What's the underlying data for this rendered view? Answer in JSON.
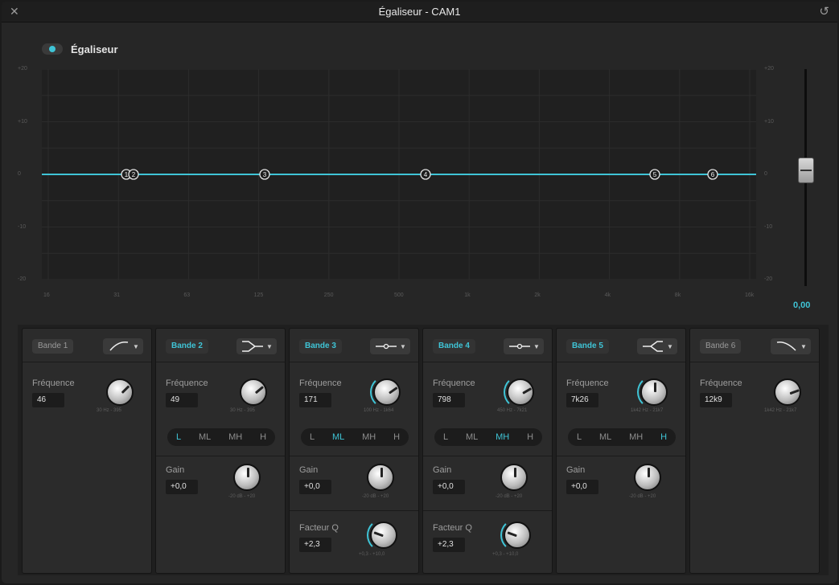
{
  "window": {
    "title": "Égaliseur - CAM1",
    "close_icon": "close-icon",
    "reset_icon": "reset-icon"
  },
  "eq_toggle": {
    "label": "Égaliseur",
    "enabled": true
  },
  "graph": {
    "y_labels": [
      "+20",
      "+10",
      "0",
      "-10",
      "-20"
    ],
    "y_labels_right": [
      "+20",
      "+10",
      "0",
      "-10",
      "-20"
    ],
    "x_labels": [
      "16",
      "31",
      "63",
      "125",
      "250",
      "500",
      "1k",
      "2k",
      "4k",
      "8k",
      "16k"
    ],
    "curve_color": "#3fc4d6",
    "nodes": [
      {
        "label": "1"
      },
      {
        "label": "2"
      },
      {
        "label": "3"
      },
      {
        "label": "4"
      },
      {
        "label": "5"
      },
      {
        "label": "6"
      }
    ]
  },
  "fader": {
    "value": "0,00",
    "level_db": 0
  },
  "bands": [
    {
      "name": "Bande 1",
      "active": false,
      "shape": "high-pass",
      "freq_label": "Fréquence",
      "freq": "46",
      "freq_range": "30 Hz - 395"
    },
    {
      "name": "Bande 2",
      "active": true,
      "shape": "low-shelf",
      "freq_label": "Fréquence",
      "freq": "49",
      "freq_range": "30 Hz - 395",
      "ranges": [
        "L",
        "ML",
        "MH",
        "H"
      ],
      "range_selected": "L",
      "gain_label": "Gain",
      "gain": "+0,0",
      "gain_range": "-20 dB - +20"
    },
    {
      "name": "Bande 3",
      "active": true,
      "shape": "bell",
      "freq_label": "Fréquence",
      "freq": "171",
      "freq_range": "100 Hz - 1k64",
      "ranges": [
        "L",
        "ML",
        "MH",
        "H"
      ],
      "range_selected": "ML",
      "gain_label": "Gain",
      "gain": "+0,0",
      "gain_range": "-20 dB - +20",
      "q_label": "Facteur Q",
      "q": "+2,3",
      "q_range": "+0,3 - +10,0"
    },
    {
      "name": "Bande 4",
      "active": true,
      "shape": "bell",
      "freq_label": "Fréquence",
      "freq": "798",
      "freq_range": "450 Hz - 7k21",
      "ranges": [
        "L",
        "ML",
        "MH",
        "H"
      ],
      "range_selected": "MH",
      "gain_label": "Gain",
      "gain": "+0,0",
      "gain_range": "-20 dB - +20",
      "q_label": "Facteur Q",
      "q": "+2,3",
      "q_range": "+0,3 - +10,0"
    },
    {
      "name": "Bande 5",
      "active": true,
      "shape": "high-shelf",
      "freq_label": "Fréquence",
      "freq": "7k26",
      "freq_range": "1k42 Hz - 21k7",
      "ranges": [
        "L",
        "ML",
        "MH",
        "H"
      ],
      "range_selected": "H",
      "gain_label": "Gain",
      "gain": "+0,0",
      "gain_range": "-20 dB - +20"
    },
    {
      "name": "Bande 6",
      "active": false,
      "shape": "low-pass",
      "freq_label": "Fréquence",
      "freq": "12k9",
      "freq_range": "1k42 Hz - 21k7"
    }
  ]
}
